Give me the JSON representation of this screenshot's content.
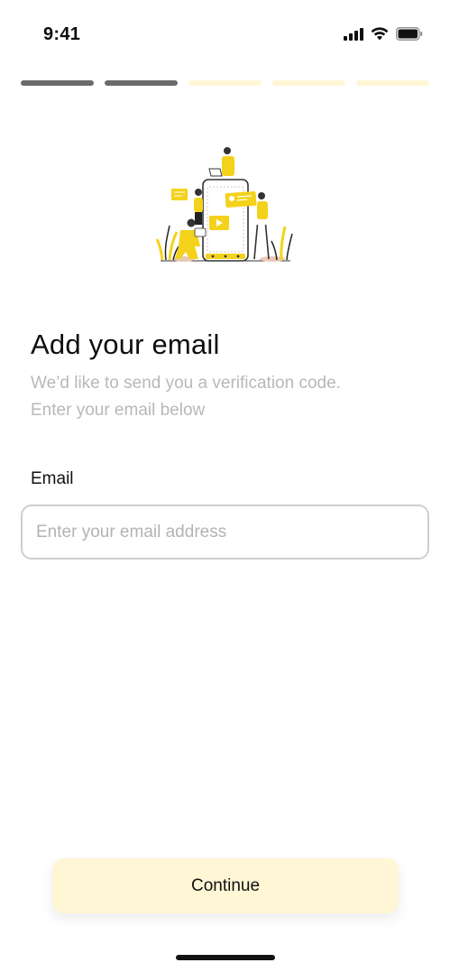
{
  "status_bar": {
    "time": "9:41",
    "signal_icon": "cellular-signal-icon",
    "wifi_icon": "wifi-icon",
    "battery_icon": "battery-icon"
  },
  "progress": {
    "total_steps": 5,
    "completed_steps": 2,
    "active_color": "#6b6b6b",
    "inactive_color": "#fff6d6"
  },
  "illustration": {
    "icon": "people-with-phone-illustration",
    "accent_color": "#f4d21b"
  },
  "header": {
    "title": "Add your email",
    "subtitle_line1": "We’d like to send you a verification code.",
    "subtitle_line2": "Enter your email below"
  },
  "form": {
    "email_label": "Email",
    "email_value": "",
    "email_placeholder": "Enter your email address"
  },
  "actions": {
    "continue_label": "Continue",
    "continue_bg": "#fff6d6"
  }
}
